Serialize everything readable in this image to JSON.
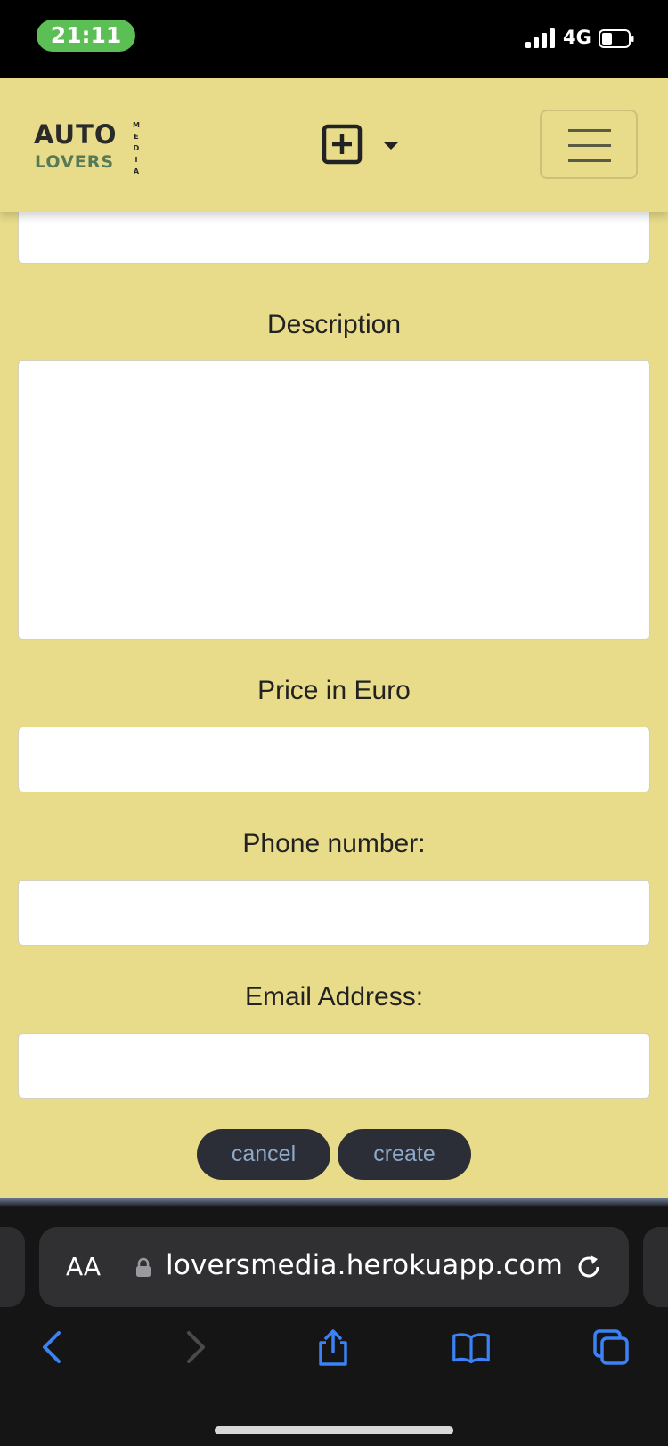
{
  "status_bar": {
    "time": "21:11",
    "network": "4G"
  },
  "navbar": {
    "logo_line1": "AUTO",
    "logo_line2": "LOVERS",
    "logo_vertical": "MEDIA",
    "add_icon": "plus-square-icon",
    "dropdown_icon": "caret-down-icon",
    "menu_icon": "hamburger-icon"
  },
  "form": {
    "description_label": "Description",
    "price_label": "Price in Euro",
    "phone_label": "Phone number:",
    "email_label": "Email Address:",
    "cancel_label": "cancel",
    "create_label": "create"
  },
  "browser": {
    "text_size_label": "AA",
    "url": "loversmedia.herokuapp.com",
    "icons": [
      "back-arrow-icon",
      "forward-arrow-icon",
      "share-icon",
      "bookmarks-icon",
      "tabs-icon"
    ]
  },
  "colors": {
    "page_background": "#e8dc8a",
    "button_background": "#2b2e37",
    "button_text": "#8fa9c9",
    "safari_accent": "#3b82f6"
  }
}
